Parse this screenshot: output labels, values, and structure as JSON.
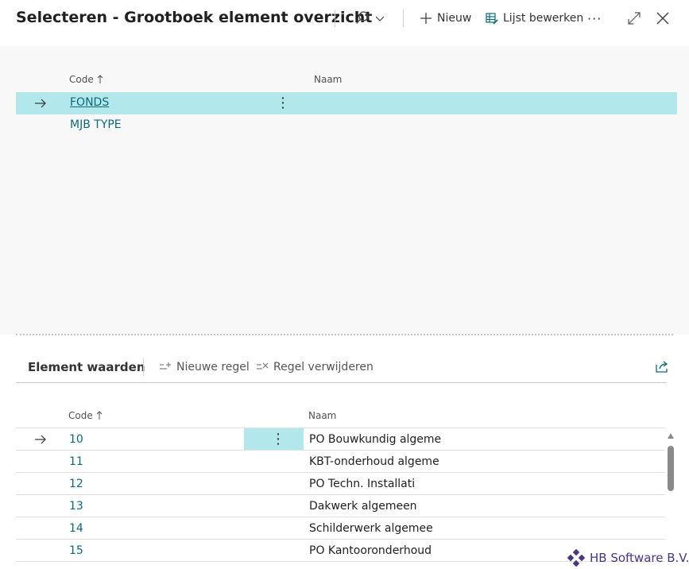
{
  "header": {
    "title": "Selecteren - Grootboek element overzicht",
    "new_label": "Nieuw",
    "edit_list_label": "Lijst bewerken",
    "more_label": "···"
  },
  "upper_list": {
    "columns": {
      "code": "Code",
      "naam": "Naam"
    },
    "rows": [
      {
        "code": "FONDS",
        "naam": "",
        "selected": true
      },
      {
        "code": "MJB TYPE",
        "naam": "",
        "selected": false
      }
    ]
  },
  "subpage": {
    "title": "Element waarden",
    "new_line_label": "Nieuwe regel",
    "delete_line_label": "Regel verwijderen",
    "columns": {
      "code": "Code",
      "naam": "Naam"
    },
    "rows": [
      {
        "code": "10",
        "naam": "PO Bouwkundig algeme",
        "selected": true
      },
      {
        "code": "11",
        "naam": "KBT-onderhoud algeme",
        "selected": false
      },
      {
        "code": "12",
        "naam": "PO Techn. Installati",
        "selected": false
      },
      {
        "code": "13",
        "naam": "Dakwerk algemeen",
        "selected": false
      },
      {
        "code": "14",
        "naam": "Schilderwerk algemee",
        "selected": false
      },
      {
        "code": "15",
        "naam": "PO Kantooronderhoud",
        "selected": false
      }
    ]
  },
  "watermark": {
    "text": "HB Software B.V."
  },
  "colors": {
    "accent": "#0b6a78",
    "selection": "#b2e8ec",
    "brand": "#4a3582"
  },
  "icons": {
    "sort": "arrow-up-icon",
    "row_indicator": "arrow-right-icon",
    "search": "search-icon",
    "new": "plus-icon",
    "edit_list": "edit-list-icon",
    "expand": "expand-icon",
    "close": "close-icon",
    "share": "share-icon"
  }
}
